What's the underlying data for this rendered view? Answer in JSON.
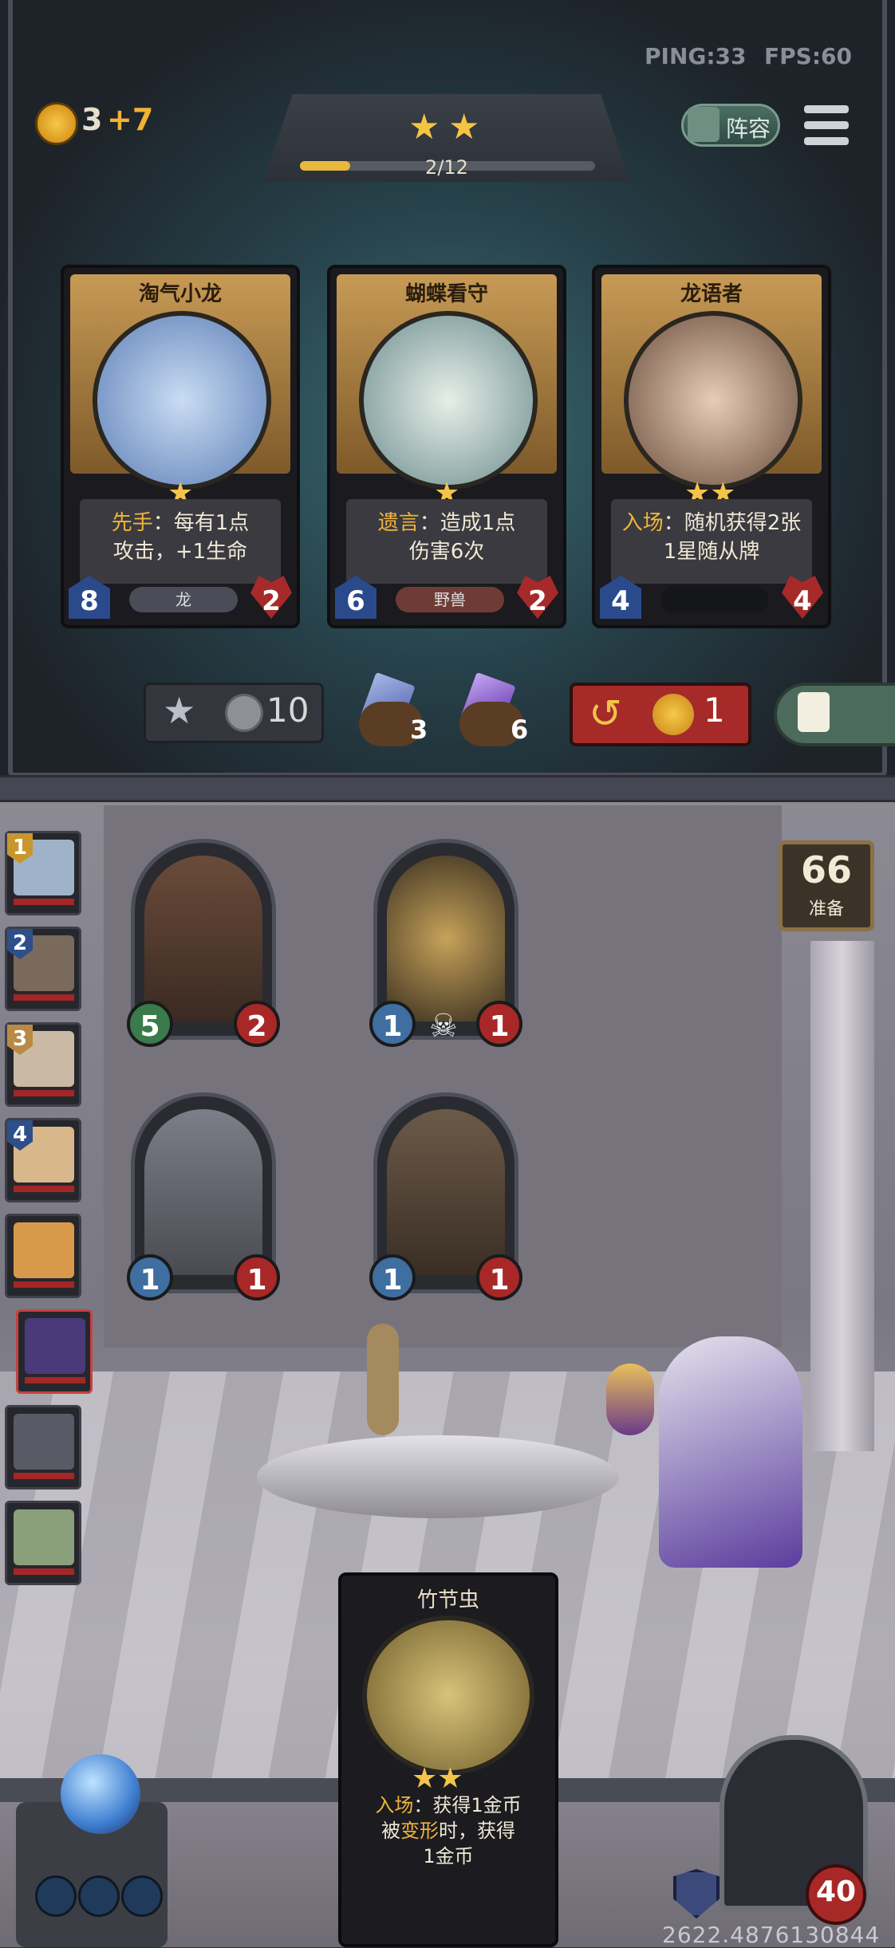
{
  "hud": {
    "ping": "PING:33",
    "fps": "FPS:60",
    "coins": "3",
    "coins_bonus": "+7",
    "tier_progress": "2/12",
    "tier_progress_fraction": 0.17,
    "tier_stars": "★",
    "lineup_label": "阵容"
  },
  "shop": {
    "cards": [
      {
        "name": "淘气小龙",
        "keyword": "先手",
        "desc1": "：每有1点",
        "desc2": "攻击，+1生命",
        "attack": "8",
        "health": "2",
        "tribe": "龙",
        "stars": "★",
        "colors": {
          "art": "#7fa6d8"
        }
      },
      {
        "name": "蝴蝶看守",
        "keyword": "遗言",
        "desc1": "：造成1点",
        "desc2": "伤害6次",
        "attack": "6",
        "health": "2",
        "tribe": "野兽",
        "stars": "★",
        "colors": {
          "art": "#9fc2c8"
        }
      },
      {
        "name": "龙语者",
        "keyword": "入场",
        "desc1": "：随机获得2张",
        "desc2": "1星随从牌",
        "attack": "4",
        "health": "4",
        "tribe": "",
        "stars": "★★",
        "colors": {
          "art": "#b38d72"
        }
      }
    ],
    "upgrade_cost": "10",
    "gem_blue_count": "3",
    "gem_purple_count": "6",
    "refresh_cost": "1"
  },
  "board": {
    "timer_value": "66",
    "timer_label": "准备",
    "minions": [
      {
        "attack": "5",
        "health": "2"
      },
      {
        "attack": "1",
        "health": "1"
      },
      {
        "attack": "1",
        "health": "1"
      },
      {
        "attack": "1",
        "health": "1"
      }
    ],
    "skull_icon": "skull-icon"
  },
  "players": [
    {
      "rank": "1"
    },
    {
      "rank": "2"
    },
    {
      "rank": "3"
    },
    {
      "rank": "4"
    },
    {
      "rank": ""
    },
    {
      "rank": ""
    },
    {
      "rank": ""
    },
    {
      "rank": ""
    }
  ],
  "hand": {
    "name": "竹节虫",
    "stars": "★★",
    "keyword": "入场",
    "desc1": "：获得1金币",
    "desc2_a": "被",
    "keyword2": "变形",
    "desc2_b": "时，获得",
    "desc3": "1金币"
  },
  "hero": {
    "health": "40"
  },
  "footer": {
    "coordinates": "2622.4876130844"
  },
  "colors": {
    "gold": "#f5c542",
    "health_red": "#a82828",
    "attack_blue": "#3f6ea0",
    "refresh_red": "#a52a28"
  }
}
